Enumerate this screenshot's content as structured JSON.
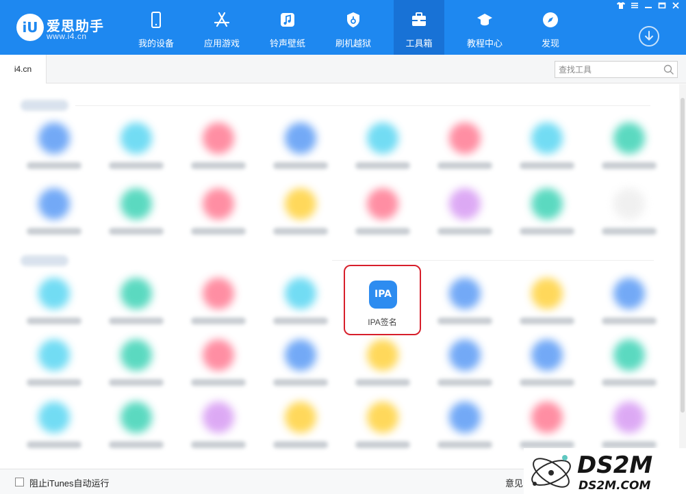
{
  "app": {
    "logo_mark": "iU",
    "name": "爱思助手",
    "url": "www.i4.cn"
  },
  "nav": {
    "items": [
      {
        "label": "我的设备",
        "icon": "phone-icon"
      },
      {
        "label": "应用游戏",
        "icon": "app-store-icon"
      },
      {
        "label": "铃声壁纸",
        "icon": "music-icon"
      },
      {
        "label": "刷机越狱",
        "icon": "shield-icon"
      },
      {
        "label": "工具箱",
        "icon": "toolbox-icon",
        "active": true
      },
      {
        "label": "教程中心",
        "icon": "graduation-cap-icon"
      },
      {
        "label": "发现",
        "icon": "compass-icon"
      }
    ]
  },
  "window_controls": [
    "shirt-icon",
    "menu-icon",
    "minimize-icon",
    "maximize-icon",
    "close-icon"
  ],
  "tabbar": {
    "tab_label": "i4.cn",
    "search_placeholder": "查找工具"
  },
  "tools": {
    "highlighted": {
      "icon_text": "IPA",
      "label": "IPA签名"
    },
    "blurred_icon_colors": [
      [
        "#5b9bf5",
        "#5ad6f2",
        "#ff7b93",
        "#5b9bf5",
        "#5ad6f2",
        "#ff7b93",
        "#5ad6f2",
        "#3fd3b6"
      ],
      [
        "#5b9bf5",
        "#3fd3b6",
        "#ff7b93",
        "#ffd23f",
        "#ff7b93",
        "#d79bf3",
        "#3fd3b6",
        "#eeeeee"
      ],
      [
        "#5ad6f2",
        "#3fd3b6",
        "#ff7b93",
        "#5ad6f2",
        null,
        "#5b9bf5",
        "#ffd23f",
        "#5b9bf5"
      ],
      [
        "#5ad6f2",
        "#3fd3b6",
        "#ff7b93",
        "#5b9bf5",
        "#ffd23f",
        "#5b9bf5",
        "#5b9bf5",
        "#3fd3b6"
      ],
      [
        "#5ad6f2",
        "#3fd3b6",
        "#d79bf3",
        "#ffd23f",
        "#ffd23f",
        "#5b9bf5",
        "#ff7b93",
        "#d79bf3"
      ]
    ]
  },
  "footer": {
    "checkbox_label": "阻止iTunes自动运行",
    "feedback_label": "意见"
  },
  "watermark": {
    "title": "DS2M",
    "subtitle": "DS2M.COM"
  },
  "colors": {
    "header_bg": "#1e88f0",
    "active_tab_bg": "#1872d6",
    "highlight_border": "#d71e2a",
    "ipa_icon_bg": "#2d8cf0"
  }
}
